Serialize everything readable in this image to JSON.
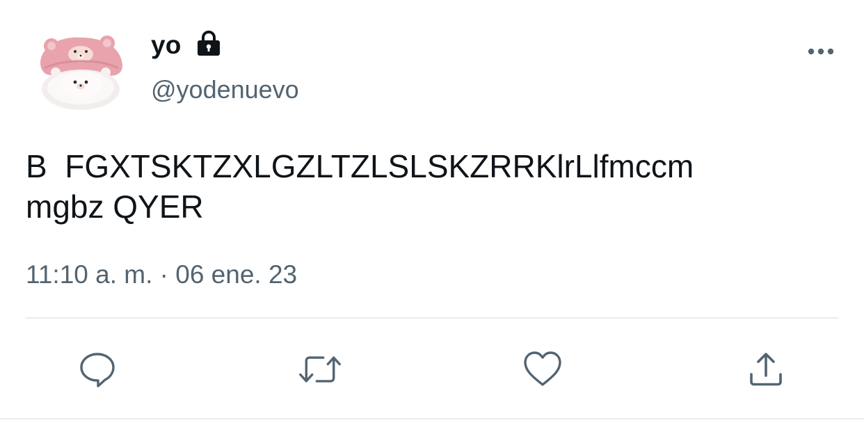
{
  "tweet": {
    "display_name": "yo",
    "handle": "@yodenuevo",
    "text": "B  FGXTSKTZXLGZLTZLSLSKZRRKlrLlfmccm\nmgbz QYER",
    "timestamp": "11:10 a. m. · 06 ene. 23"
  },
  "icons": {
    "lock": "lock-icon",
    "more": "more-horizontal-icon",
    "reply": "reply-icon",
    "retweet": "retweet-icon",
    "like": "heart-icon",
    "share": "share-icon"
  },
  "colors": {
    "text_primary": "#0f1419",
    "text_secondary": "#536471",
    "icon": "#536471",
    "divider": "#e6ecf0",
    "avatar_pink": "#e8a3ad"
  }
}
